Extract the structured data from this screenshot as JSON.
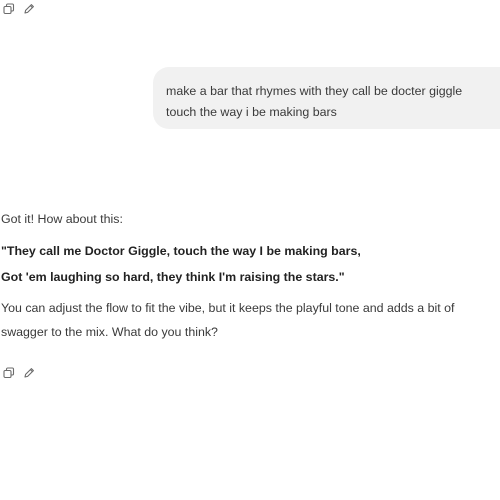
{
  "user_message": {
    "text": "make a bar that rhymes with they call be docter giggle touch the way i be making bars"
  },
  "assistant_message": {
    "intro": "Got it! How about this:",
    "bar_lines": [
      "\"They call me Doctor Giggle, touch the way I be making bars,",
      "Got 'em laughing so hard, they think I'm raising the stars.\""
    ],
    "outro": "You can adjust the flow to fit the vibe, but it keeps the playful tone and adds a bit of swagger to the mix. What do you think?"
  },
  "actions": {
    "copy_icon": "copy-icon",
    "edit_icon": "pencil-icon"
  },
  "colors": {
    "text": "#3a3a3a",
    "bubble_bg": "#f1f1f1",
    "icon": "#6b6b6b"
  }
}
